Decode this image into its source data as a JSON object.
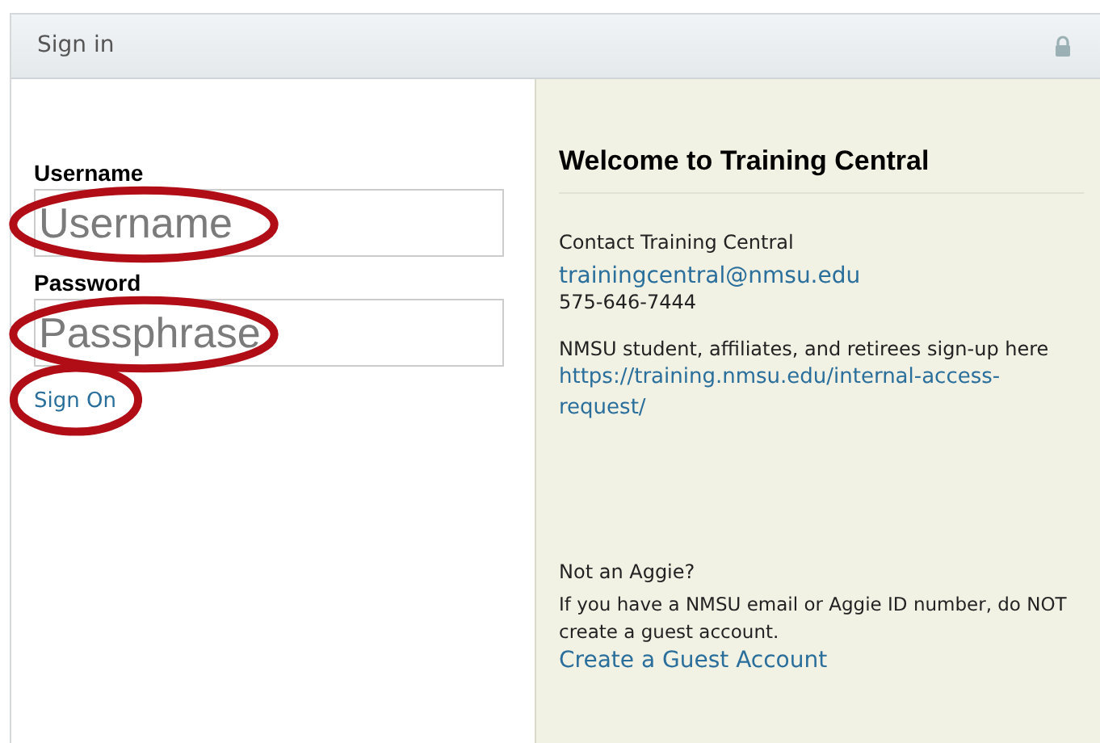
{
  "window": {
    "title": "Sign in"
  },
  "form": {
    "fields": [
      {
        "label": "Username",
        "placeholder": "Username",
        "circled": true
      },
      {
        "label": "Password",
        "placeholder": "Passphrase",
        "circled": true
      }
    ],
    "submit": {
      "label": "Sign On",
      "circled": true
    }
  },
  "info": {
    "title": "Welcome to Training Central",
    "contact": {
      "label": "Contact Training Central",
      "email": "trainingcentral@nmsu.edu",
      "phone": "575-646-7444"
    },
    "signup": {
      "text": "NMSU student, affiliates, and retirees sign-up here",
      "link": "https://training.nmsu.edu/internal-access-request/"
    },
    "guest": {
      "heading": "Not an Aggie?",
      "text": "If you have a NMSU email or Aggie ID number, do NOT create a guest account.",
      "link": "Create a Guest Account"
    }
  }
}
